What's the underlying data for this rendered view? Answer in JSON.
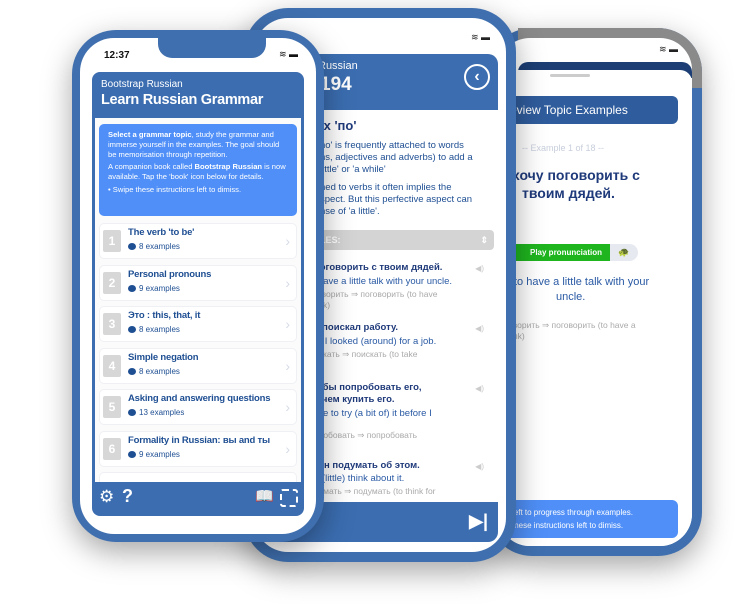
{
  "front": {
    "time": "12:37",
    "header_subtitle": "Bootstrap Russian",
    "header_title": "Learn Russian Grammar",
    "instructions": {
      "p1_bold": "Select a grammar topic",
      "p1_rest": ", study the grammar and immerse yourself in the examples. The goal should be memorisation through repetition.",
      "p2_a": "A companion book called ",
      "p2_bold": "Bootstrap Russian",
      "p2_b": " is now available. Tap the 'book' icon below for details.",
      "p3": "• Swipe these instructions left to dimiss."
    },
    "topics": [
      {
        "num": "1",
        "title": "The verb 'to be'",
        "count": "8 examples"
      },
      {
        "num": "2",
        "title": "Personal pronouns",
        "count": "9 examples"
      },
      {
        "num": "3",
        "title": "Это : this, that, it",
        "count": "8 examples"
      },
      {
        "num": "4",
        "title": "Simple negation",
        "count": "8 examples"
      },
      {
        "num": "5",
        "title": "Asking and answering questions",
        "count": "13 examples"
      },
      {
        "num": "6",
        "title": "Formality in Russian: вы and ты",
        "count": "9 examples"
      }
    ],
    "toolbar_icons": [
      "gear-icon",
      "question-icon",
      "book-icon",
      "qr-code-icon"
    ]
  },
  "middle": {
    "header_subtitle": "Russian",
    "header_title": "194",
    "topic_title": "ix 'по'",
    "para1": [
      "no' is frequently attached to words",
      "ns, adjectives and adverbs) to add a",
      "little' or 'a while'"
    ],
    "para2": [
      "hed to verbs it often implies the",
      "spect. But this perfective aspect can",
      "nse of 'a little'."
    ],
    "select_label": "LES:",
    "examples": [
      {
        "ru": [
          "поговорить с твоим дядей."
        ],
        "en": "o have a little talk with your uncle.",
        "note": [
          "говорить ⇒ поговорить (to have",
          "talk)"
        ]
      },
      {
        "ru": [
          "я поискал работу."
        ],
        "en": "lay I looked (around) for a job.",
        "note": [
          "искать ⇒ поискать (to take",
          ")"
        ]
      },
      {
        "ru": [
          "л бы попробовать его,",
          "е чем купить его."
        ],
        "en": "like to try (a bit of) it before I",
        "note": [
          "пробовать ⇒ попробовать",
          ")"
        ]
      },
      {
        "ru": [
          "кен подумать об этом."
        ],
        "en": "o (little) think about it.",
        "note": [
          "думать ⇒ подумать (to think for"
        ]
      }
    ]
  },
  "back": {
    "header": "eview Topic Examples",
    "counter": "-- Example 1 of 18 --",
    "russian": [
      "хочу поговорить с",
      "твоим дядей."
    ],
    "play_label": "Play pronunciation",
    "english": [
      "to have a little talk with your",
      "uncle."
    ],
    "note": [
      "оворить ⇒ поговорить (to have a",
      "алk)"
    ],
    "instructions": [
      "left to progress through examples.",
      "these instructions left to dimiss."
    ]
  },
  "colors": {
    "frame": "#3f6fae",
    "header": "#3b6db0",
    "instructions_bg": "#4f8ff7",
    "play": "#1fb51f",
    "text_blue": "#1f4f93"
  }
}
